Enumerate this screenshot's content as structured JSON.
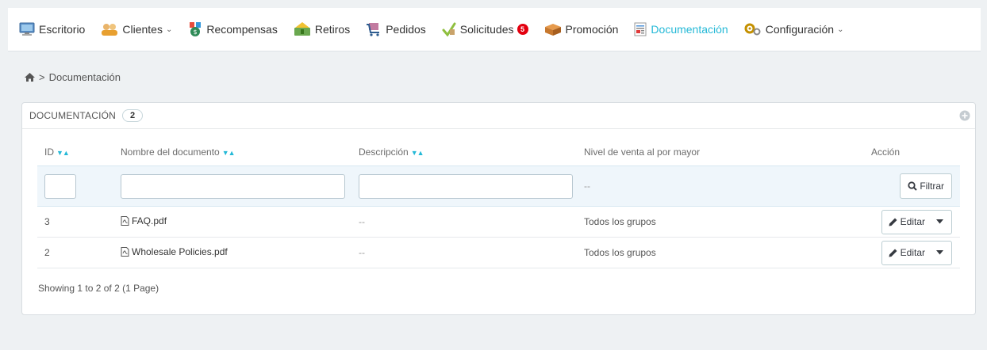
{
  "nav": {
    "items": [
      {
        "label": "Escritorio",
        "icon": "desktop-icon"
      },
      {
        "label": "Clientes",
        "icon": "customers-icon",
        "dropdown": true
      },
      {
        "label": "Recompensas",
        "icon": "rewards-icon"
      },
      {
        "label": "Retiros",
        "icon": "withdrawals-icon"
      },
      {
        "label": "Pedidos",
        "icon": "orders-icon"
      },
      {
        "label": "Solicitudes",
        "icon": "requests-icon",
        "badge": "5"
      },
      {
        "label": "Promoción",
        "icon": "promotion-icon"
      },
      {
        "label": "Documentación",
        "icon": "documentation-icon",
        "active": true
      },
      {
        "label": "Configuración",
        "icon": "settings-icon",
        "dropdown": true
      }
    ]
  },
  "breadcrumb": {
    "separator": ">",
    "current": "Documentación"
  },
  "panel": {
    "title": "DOCUMENTACIÓN",
    "count": "2"
  },
  "table": {
    "headers": {
      "id": "ID",
      "name": "Nombre del documento",
      "description": "Descripción",
      "level": "Nivel de venta al por mayor",
      "action": "Acción"
    },
    "filter": {
      "level_value": "--",
      "button_label": "Filtrar"
    },
    "rows": [
      {
        "id": "3",
        "name": "FAQ.pdf",
        "description": "--",
        "level": "Todos los grupos",
        "action": "Editar"
      },
      {
        "id": "2",
        "name": "Wholesale Policies.pdf",
        "description": "--",
        "level": "Todos los grupos",
        "action": "Editar"
      }
    ]
  },
  "pagination": {
    "text": "Showing 1 to 2 of 2 (1 Page)"
  },
  "colors": {
    "accent": "#25b9d7",
    "badge": "#e3000f",
    "filter_bg": "#eff6fb"
  }
}
